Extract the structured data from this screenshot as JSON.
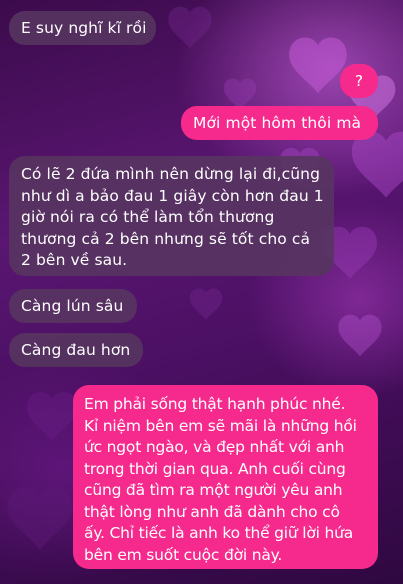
{
  "theme": {
    "incoming_bubble": "#563660",
    "outgoing_bubble": "#f52a8c",
    "text": "#ffffff"
  },
  "messages": [
    {
      "direction": "incoming",
      "lines": [
        "E suy nghĩ kĩ rồi"
      ]
    },
    {
      "direction": "outgoing",
      "lines": [
        "?"
      ]
    },
    {
      "direction": "outgoing",
      "lines": [
        "Mới một hôm thôi mà"
      ]
    },
    {
      "direction": "incoming",
      "lines": [
        "Có lẽ 2 đứa mình nên dừng lại đi,cũng",
        "như dì a bảo đau 1 giây còn hơn đau 1",
        "giờ nói ra có thể làm tổn thương",
        "thương cả 2 bên nhưng sẽ tốt cho  cả",
        "2 bên về sau."
      ]
    },
    {
      "direction": "incoming",
      "lines": [
        "Càng lún sâu"
      ]
    },
    {
      "direction": "incoming",
      "lines": [
        "Càng đau hơn"
      ]
    },
    {
      "direction": "outgoing",
      "lines": [
        "Em phải sống thật hạnh phúc nhé.",
        "Kỉ niệm bên em sẽ mãi là những hồi",
        "ức ngọt ngào, và đẹp nhất với anh",
        "trong thời gian qua. Anh cuối cùng",
        "cũng đã tìm ra một người yêu anh",
        "thật lòng như anh đã dành cho cô",
        "ấy. Chỉ tiếc là anh ko thể giữ lời hứa",
        "bên em suốt cuộc đời này."
      ]
    }
  ]
}
